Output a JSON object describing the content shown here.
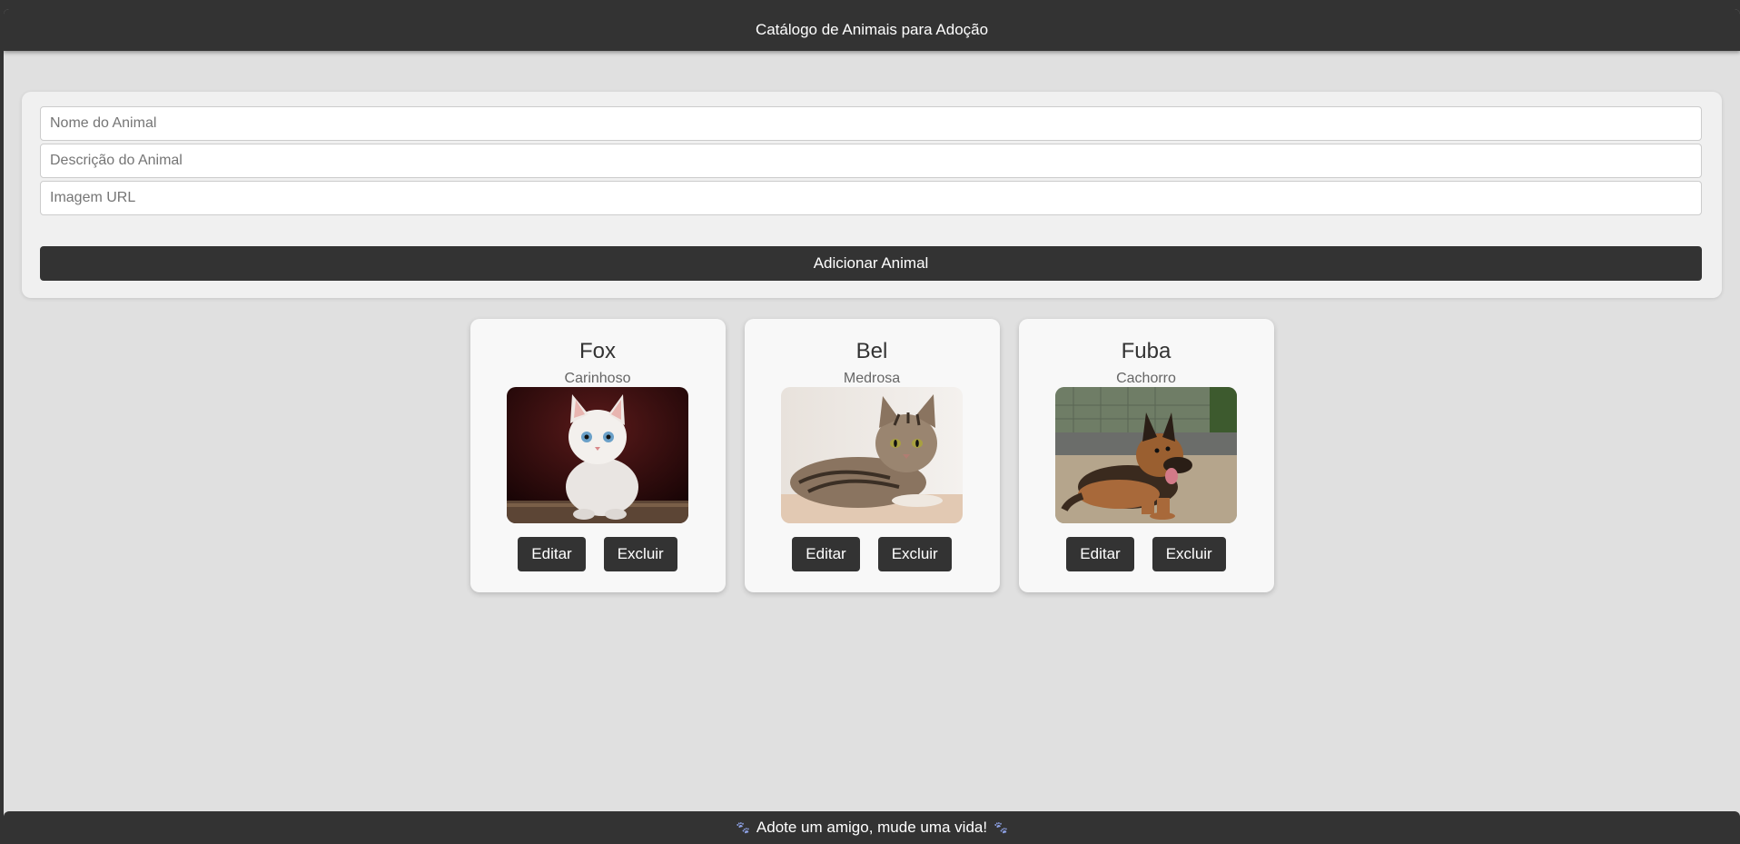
{
  "header": {
    "title": "Catálogo de Animais para Adoção"
  },
  "form": {
    "name_placeholder": "Nome do Animal",
    "description_placeholder": "Descrição do Animal",
    "image_placeholder": "Imagem URL",
    "add_button_label": "Adicionar Animal"
  },
  "animals": [
    {
      "name": "Fox",
      "description": "Carinhoso",
      "image": "white-kitten-photo",
      "edit_label": "Editar",
      "delete_label": "Excluir"
    },
    {
      "name": "Bel",
      "description": "Medrosa",
      "image": "tabby-cat-photo",
      "edit_label": "Editar",
      "delete_label": "Excluir"
    },
    {
      "name": "Fuba",
      "description": "Cachorro",
      "image": "german-shepherd-photo",
      "edit_label": "Editar",
      "delete_label": "Excluir"
    }
  ],
  "footer": {
    "text": "Adote um amigo, mude uma vida!",
    "icon": "paw-icon"
  },
  "colors": {
    "dark": "#333333",
    "background": "#e0e0e0",
    "card": "#f8f8f8",
    "form_panel": "#f0f0f0"
  }
}
